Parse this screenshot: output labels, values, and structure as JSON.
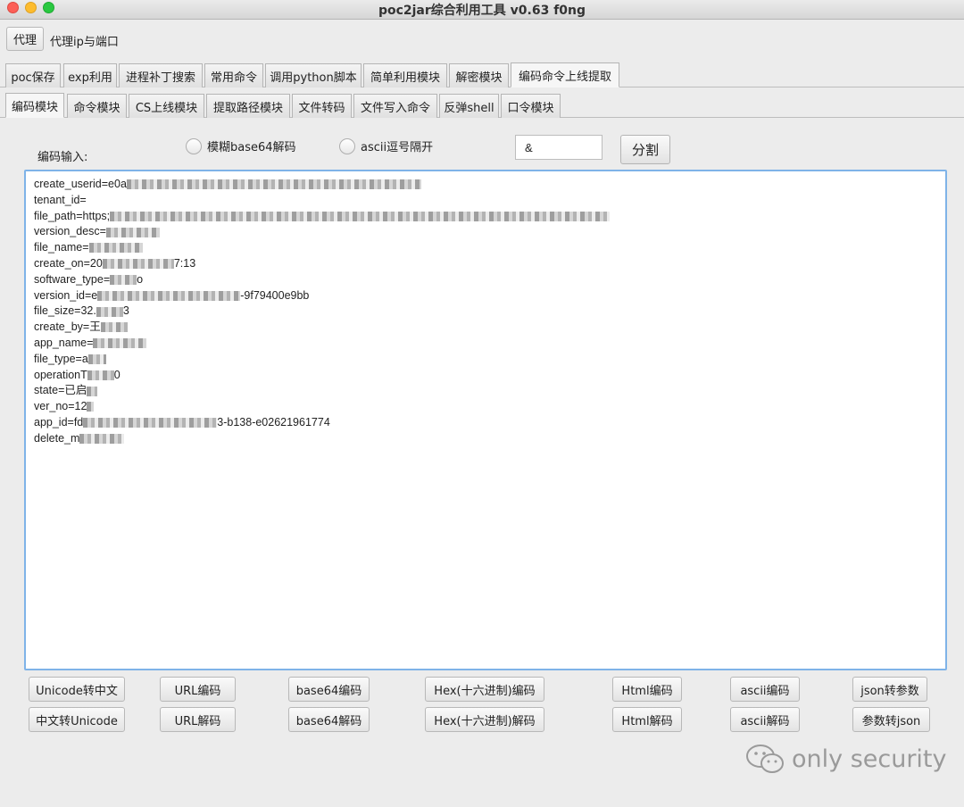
{
  "window": {
    "title": "poc2jar综合利用工具 v0.63  f0ng"
  },
  "proxy": {
    "button_label": "代理",
    "label": "代理ip与端口"
  },
  "main_tabs": [
    "poc保存",
    "exp利用",
    "进程补丁搜索",
    "常用命令",
    "调用python脚本",
    "简单利用模块",
    "解密模块",
    "编码命令上线提取"
  ],
  "sub_tabs": [
    "编码模块",
    "命令模块",
    "CS上线模块",
    "提取路径模块",
    "文件转码",
    "文件写入命令",
    "反弹shell",
    "口令模块"
  ],
  "encode": {
    "input_label": "编码输入:",
    "radio_base64": "模糊base64解码",
    "radio_ascii": "ascii逗号隔开",
    "separator_value": "&",
    "split_button": "分割"
  },
  "textarea_lines": [
    {
      "text": "create_userid=e0a",
      "blur": "330px"
    },
    {
      "text": "tenant_id=",
      "blur": ""
    },
    {
      "text": "file_path=https;",
      "blur": "560px"
    },
    {
      "text": "version_desc=",
      "blur": "60px"
    },
    {
      "text": "file_name=",
      "blur": "60px"
    },
    {
      "text": "create_on=20",
      "blur": "80px",
      "tail": "7:13"
    },
    {
      "text": "software_type=",
      "blur": "30px",
      "tail": "o"
    },
    {
      "text": "version_id=e",
      "blur": "160px",
      "tail": "-9f79400e9bb"
    },
    {
      "text": "file_size=32.",
      "blur": "30px",
      "tail": "3"
    },
    {
      "text": "create_by=王",
      "blur": "30px"
    },
    {
      "text": "app_name=",
      "blur": "60px"
    },
    {
      "text": "file_type=a",
      "blur": "20px"
    },
    {
      "text": "operationT",
      "blur": "30px",
      "tail": "0"
    },
    {
      "text": "state=已启",
      "blur": "12px"
    },
    {
      "text": "ver_no=12",
      "blur": "8px"
    },
    {
      "text": "app_id=fd",
      "blur": "150px",
      "tail": "3-b138-e02621961774"
    },
    {
      "text": "delete_m",
      "blur": "50px"
    }
  ],
  "buttons_row1": [
    "Unicode转中文",
    "URL编码",
    "base64编码",
    "Hex(十六进制)编码",
    "Html编码",
    "ascii编码",
    "json转参数"
  ],
  "buttons_row2": [
    "中文转Unicode",
    "URL解码",
    "base64解码",
    "Hex(十六进制)解码",
    "Html解码",
    "ascii解码",
    "参数转json"
  ],
  "watermark": {
    "text": "only security",
    "icon": "wechat-icon"
  }
}
